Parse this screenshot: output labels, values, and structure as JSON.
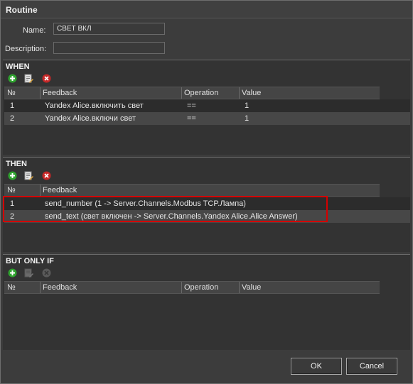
{
  "window": {
    "title": "Routine"
  },
  "form": {
    "name_label": "Name:",
    "name_value": "СВЕТ ВКЛ",
    "description_label": "Description:",
    "description_value": ""
  },
  "when": {
    "title": "WHEN",
    "toolbar": [
      "add-icon",
      "edit-icon",
      "delete-icon"
    ],
    "columns": [
      "№",
      "Feedback",
      "Operation",
      "Value"
    ],
    "rows": [
      {
        "num": "1",
        "feedback": "Yandex Alice.включить свет",
        "operation": "==",
        "value": "1"
      },
      {
        "num": "2",
        "feedback": "Yandex Alice.включи свет",
        "operation": "==",
        "value": "1"
      }
    ]
  },
  "then": {
    "title": "THEN",
    "toolbar": [
      "add-icon",
      "edit-icon",
      "delete-icon"
    ],
    "columns": [
      "№",
      "Feedback"
    ],
    "rows": [
      {
        "num": "1",
        "feedback": "send_number (1 -> Server.Channels.Modbus TCP.Лампа)"
      },
      {
        "num": "2",
        "feedback": "send_text (свет включен -> Server.Channels.Yandex Alice.Alice Answer)"
      }
    ]
  },
  "only_if": {
    "title": "BUT ONLY IF",
    "toolbar": [
      "add-icon",
      "edit-icon-disabled",
      "delete-icon-disabled"
    ],
    "columns": [
      "№",
      "Feedback",
      "Operation",
      "Value"
    ],
    "rows": []
  },
  "buttons": {
    "ok": "OK",
    "cancel": "Cancel"
  },
  "colors": {
    "highlight": "#d40000",
    "add": "#2fa32f",
    "delete": "#c62828"
  }
}
